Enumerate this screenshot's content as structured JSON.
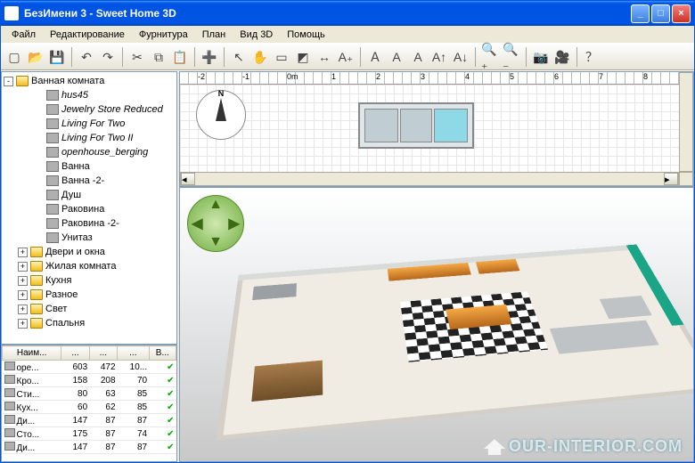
{
  "window": {
    "title": "БезИмени 3 - Sweet Home 3D"
  },
  "menus": [
    "Файл",
    "Редактирование",
    "Фурнитура",
    "План",
    "Вид 3D",
    "Помощь"
  ],
  "toolbar_icons": [
    "new-icon",
    "open-icon",
    "save-icon",
    "sep",
    "undo-icon",
    "redo-icon",
    "sep",
    "cut-icon",
    "copy-icon",
    "paste-icon",
    "sep",
    "add-furniture-icon",
    "sep",
    "select-icon",
    "pan-icon",
    "wall-icon",
    "room-icon",
    "dimension-icon",
    "text-icon",
    "sep",
    "insert-text-icon",
    "font-bold-icon",
    "font-italic-icon",
    "increase-size-icon",
    "decrease-size-icon",
    "sep",
    "zoom-in-icon",
    "zoom-out-icon",
    "sep",
    "photo-icon",
    "video-icon",
    "sep",
    "help-icon"
  ],
  "toolbar_glyphs": {
    "new-icon": "▢",
    "open-icon": "📂",
    "save-icon": "💾",
    "undo-icon": "↶",
    "redo-icon": "↷",
    "cut-icon": "✂",
    "copy-icon": "⧉",
    "paste-icon": "📋",
    "add-furniture-icon": "➕",
    "select-icon": "↖",
    "pan-icon": "✋",
    "wall-icon": "▭",
    "room-icon": "◩",
    "dimension-icon": "↔",
    "text-icon": "A₊",
    "insert-text-icon": "Ａ",
    "font-bold-icon": "A",
    "font-italic-icon": "A",
    "increase-size-icon": "A↑",
    "decrease-size-icon": "A↓",
    "zoom-in-icon": "🔍₊",
    "zoom-out-icon": "🔍₋",
    "photo-icon": "📷",
    "video-icon": "🎥",
    "help-icon": "？"
  },
  "tree": {
    "root": {
      "label": "Ванная комната",
      "expanded": true,
      "type": "folder"
    },
    "children": [
      {
        "label": "hus45",
        "italic": true
      },
      {
        "label": "Jewelry Store Reduced",
        "italic": true
      },
      {
        "label": "Living For Two",
        "italic": true
      },
      {
        "label": "Living For Two II",
        "italic": true
      },
      {
        "label": "openhouse_berging",
        "italic": true
      },
      {
        "label": "Ванна"
      },
      {
        "label": "Ванна -2-"
      },
      {
        "label": "Душ"
      },
      {
        "label": "Раковина"
      },
      {
        "label": "Раковина -2-"
      },
      {
        "label": "Унитаз"
      }
    ],
    "siblings": [
      {
        "label": "Двери и окна"
      },
      {
        "label": "Жилая комната"
      },
      {
        "label": "Кухня"
      },
      {
        "label": "Разное"
      },
      {
        "label": "Свет"
      },
      {
        "label": "Спальня"
      }
    ]
  },
  "table": {
    "headers": [
      "Наим...",
      "...",
      "...",
      "...",
      "В..."
    ],
    "rows": [
      {
        "name": "оре...",
        "c1": "603",
        "c2": "472",
        "c3": "10...",
        "vis": true
      },
      {
        "name": "Кро...",
        "c1": "158",
        "c2": "208",
        "c3": "70",
        "vis": true
      },
      {
        "name": "Сти...",
        "c1": "80",
        "c2": "63",
        "c3": "85",
        "vis": true
      },
      {
        "name": "Кух...",
        "c1": "60",
        "c2": "62",
        "c3": "85",
        "vis": true
      },
      {
        "name": "Ди...",
        "c1": "147",
        "c2": "87",
        "c3": "87",
        "vis": true
      },
      {
        "name": "Сто...",
        "c1": "175",
        "c2": "87",
        "c3": "74",
        "vis": true
      },
      {
        "name": "Ди...",
        "c1": "147",
        "c2": "87",
        "c3": "87",
        "vis": true
      }
    ]
  },
  "ruler": {
    "marks": [
      "-2",
      "-1",
      "0m",
      "1",
      "2",
      "3",
      "4",
      "5",
      "6",
      "7",
      "8"
    ]
  },
  "watermark": "OUR-INTERIOR.COM",
  "compass_label": "N"
}
